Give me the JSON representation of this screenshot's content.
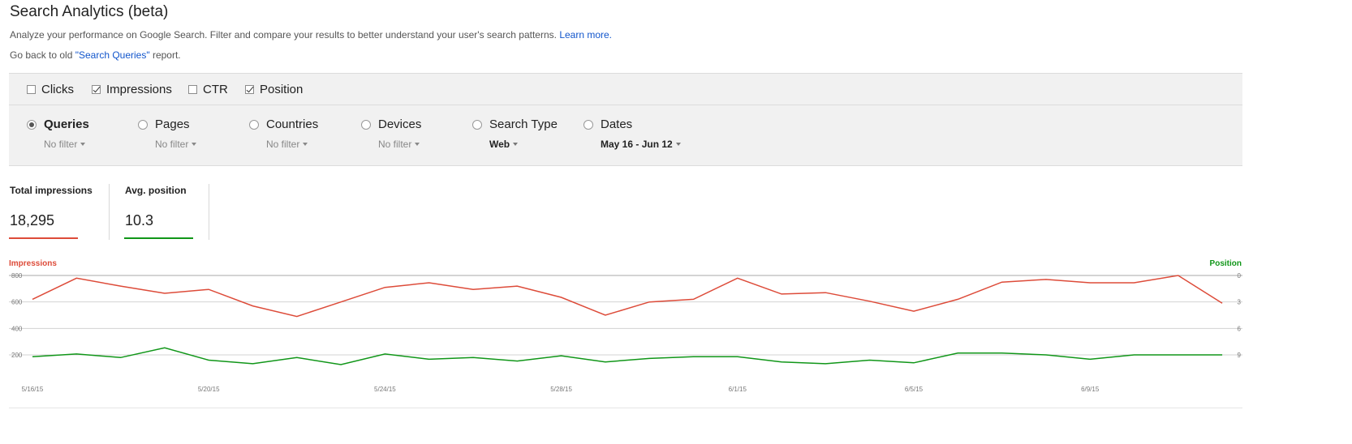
{
  "page": {
    "title": "Search Analytics (beta)",
    "description": "Analyze your performance on Google Search. Filter and compare your results to better understand your user's search patterns.",
    "learn_more": "Learn more.",
    "go_back_prefix": "Go back to old ",
    "go_back_link": "\"Search Queries\"",
    "go_back_suffix": " report."
  },
  "metrics": [
    {
      "label": "Clicks",
      "checked": false
    },
    {
      "label": "Impressions",
      "checked": true
    },
    {
      "label": "CTR",
      "checked": false
    },
    {
      "label": "Position",
      "checked": true
    }
  ],
  "dimensions": [
    {
      "label": "Queries",
      "filter": "No filter",
      "selected": true
    },
    {
      "label": "Pages",
      "filter": "No filter",
      "selected": false
    },
    {
      "label": "Countries",
      "filter": "No filter",
      "selected": false
    },
    {
      "label": "Devices",
      "filter": "No filter",
      "selected": false
    },
    {
      "label": "Search Type",
      "filter": "Web",
      "selected": false
    },
    {
      "label": "Dates",
      "filter": "May 16 - Jun 12",
      "selected": false
    }
  ],
  "summary": {
    "impressions_label": "Total impressions",
    "impressions_value": "18,295",
    "position_label": "Avg. position",
    "position_value": "10.3"
  },
  "colors": {
    "impressions": "#dd4b39",
    "position": "#109618"
  },
  "chart_data": {
    "type": "line",
    "left_axis_title": "Impressions",
    "right_axis_title": "Position",
    "left_ticks": [
      "800",
      "600",
      "400",
      "200"
    ],
    "right_ticks": [
      "0",
      "3",
      "6",
      "9"
    ],
    "ylim_left": [
      200,
      800
    ],
    "ylim_right": [
      9,
      0
    ],
    "x_tick_labels": [
      "5/16/15",
      "5/20/15",
      "5/24/15",
      "5/28/15",
      "6/1/15",
      "6/5/15",
      "6/9/15"
    ],
    "x": [
      "5/16/15",
      "5/17/15",
      "5/18/15",
      "5/19/15",
      "5/20/15",
      "5/21/15",
      "5/22/15",
      "5/23/15",
      "5/24/15",
      "5/25/15",
      "5/26/15",
      "5/27/15",
      "5/28/15",
      "5/29/15",
      "5/30/15",
      "5/31/15",
      "6/1/15",
      "6/2/15",
      "6/3/15",
      "6/4/15",
      "6/5/15",
      "6/6/15",
      "6/7/15",
      "6/8/15",
      "6/9/15",
      "6/10/15",
      "6/11/15",
      "6/12/15"
    ],
    "series": [
      {
        "name": "Impressions",
        "axis": "left",
        "values": [
          620,
          780,
          720,
          665,
          695,
          570,
          490,
          600,
          710,
          745,
          695,
          720,
          635,
          500,
          600,
          620,
          780,
          660,
          670,
          605,
          530,
          620,
          750,
          770,
          745,
          745,
          800,
          590
        ]
      },
      {
        "name": "Position",
        "axis": "right",
        "values": [
          9.2,
          8.9,
          9.3,
          8.2,
          9.6,
          10.0,
          9.3,
          10.1,
          8.9,
          9.5,
          9.3,
          9.7,
          9.1,
          9.8,
          9.4,
          9.2,
          9.2,
          9.8,
          10.0,
          9.6,
          9.9,
          8.8,
          8.8,
          9.0,
          9.5,
          9.0,
          9.0,
          9.0
        ]
      }
    ]
  }
}
